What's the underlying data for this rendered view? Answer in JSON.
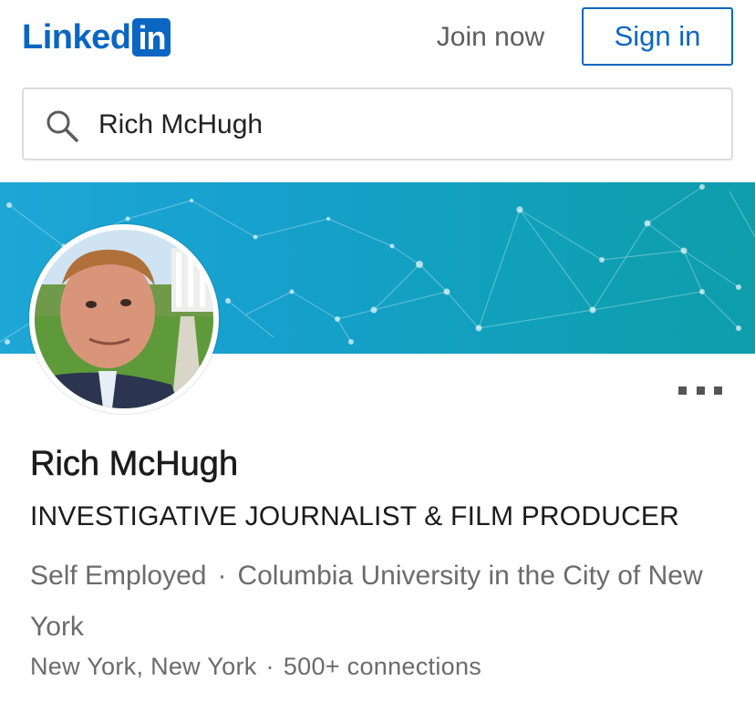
{
  "header": {
    "logo_text": "Linked",
    "logo_box_text": "in",
    "brand_color": "#0a66c2",
    "join_label": "Join now",
    "signin_label": "Sign in"
  },
  "search": {
    "icon": "search-icon",
    "value": "Rich McHugh"
  },
  "profile": {
    "name": "Rich McHugh",
    "headline": "INVESTIGATIVE JOURNALIST & FILM PRODUCER",
    "employer": "Self Employed",
    "school": "Columbia University in the City of New York",
    "location": "New York, New York",
    "connections": "500+ connections",
    "separator": "·"
  },
  "actions": {
    "more_icon": "more-horizontal-icon"
  }
}
